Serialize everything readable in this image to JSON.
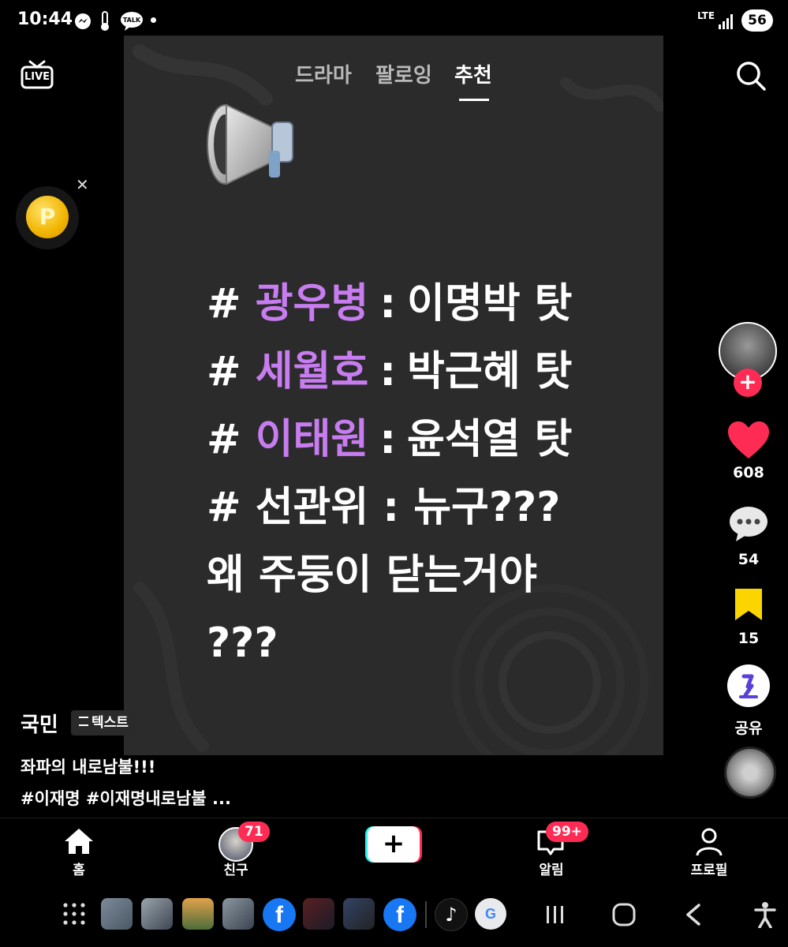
{
  "status_bar": {
    "time": "10:44",
    "network": "LTE",
    "battery": "56",
    "icons": [
      "messenger-icon",
      "thermometer-icon",
      "talk-icon",
      "dot-icon",
      "signal-icon"
    ]
  },
  "top_tabs": [
    {
      "label": "드라마",
      "active": false
    },
    {
      "label": "팔로잉",
      "active": false
    },
    {
      "label": "추천",
      "active": true
    }
  ],
  "live_label": "LIVE",
  "coin_label": "P",
  "post": {
    "lines": [
      {
        "prefix": "#",
        "highlight": "광우병",
        "colon": ":",
        "rest": "이명박 탓"
      },
      {
        "prefix": "#",
        "highlight": "세월호",
        "colon": ":",
        "rest": "박근혜 탓"
      },
      {
        "prefix": "#",
        "highlight": "이태원",
        "colon": ":",
        "rest": "윤석열 탓"
      },
      {
        "prefix": "#",
        "highlight": "",
        "colon": "",
        "rest": "선관위 : 뉴구???"
      },
      {
        "prefix": "",
        "highlight": "",
        "colon": "",
        "rest": "왜 주둥이 닫는거야"
      },
      {
        "prefix": "",
        "highlight": "",
        "colon": "",
        "rest": "???"
      }
    ],
    "highlight_color": "#c77cf0"
  },
  "actions": {
    "likes": "608",
    "comments": "54",
    "saves": "15",
    "share_label": "공유",
    "follow_symbol": "+"
  },
  "caption": {
    "author": "국민",
    "type_badge": "텍스트",
    "line1": "좌파의 내로남불!!!",
    "line2": "#이재명 #이재명내로남불 ..."
  },
  "bottom_nav": {
    "home": "홈",
    "friends": "친구",
    "friends_badge": "71",
    "create": "+",
    "inbox": "알림",
    "inbox_badge": "99+",
    "profile": "프로필"
  },
  "colors": {
    "accent_red": "#fe2c55",
    "save_yellow": "#fcd500",
    "facebook_blue": "#1877f2"
  }
}
